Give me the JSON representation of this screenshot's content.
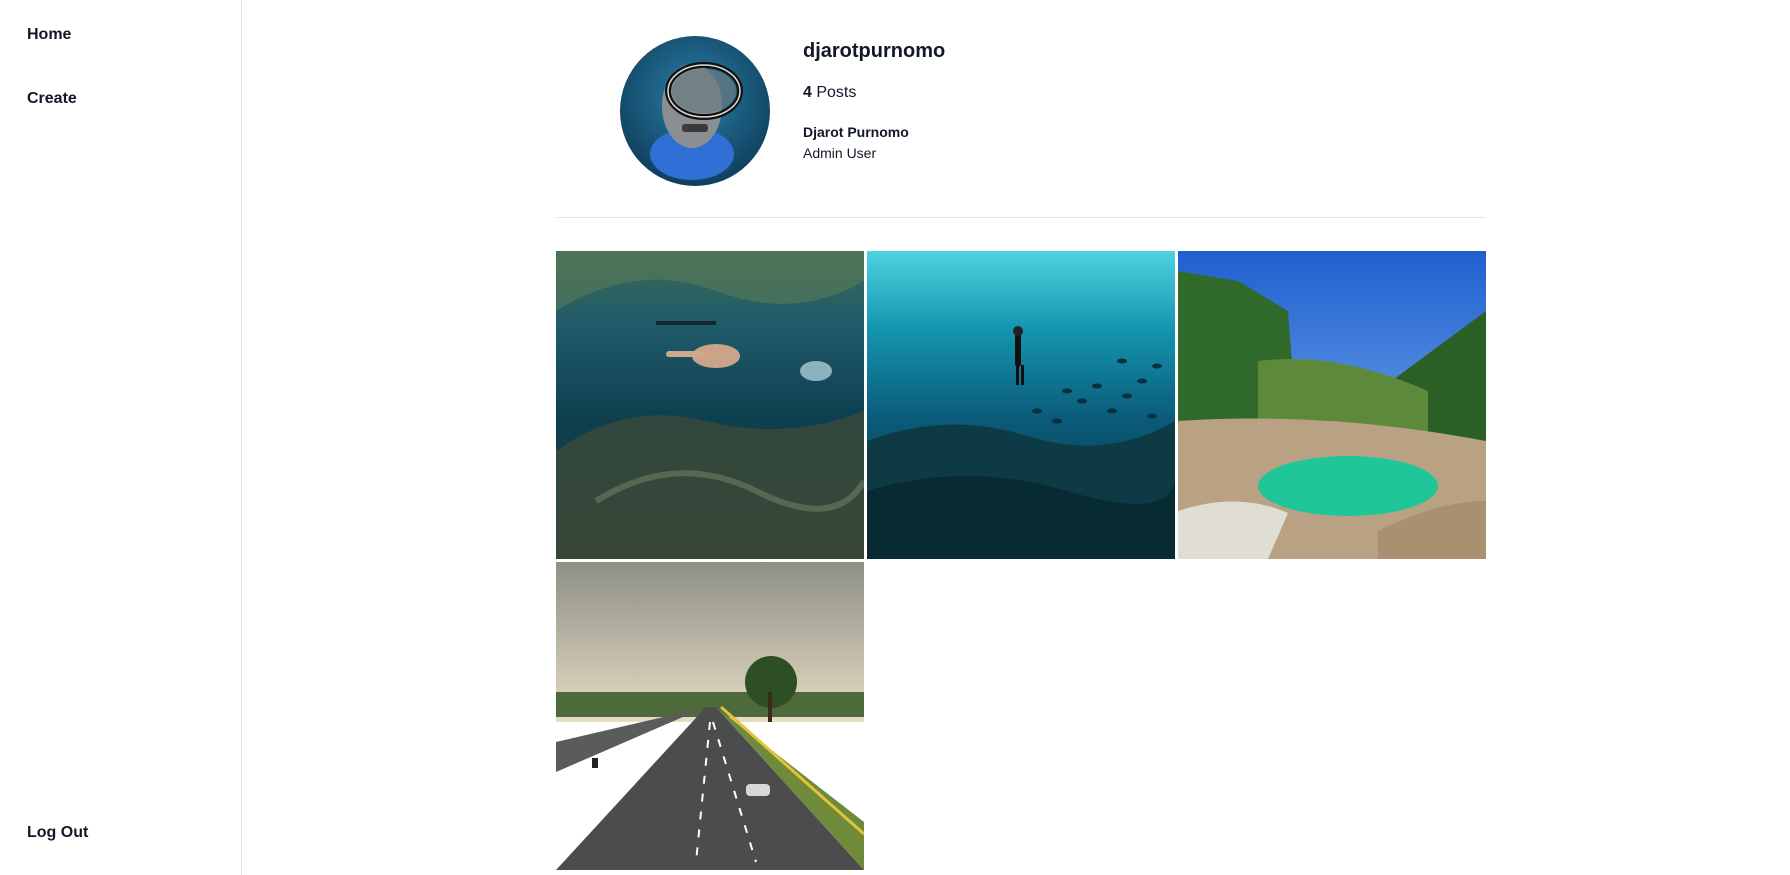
{
  "sidebar": {
    "home": "Home",
    "create": "Create",
    "logout": "Log Out"
  },
  "profile": {
    "username": "djarotpurnomo",
    "post_count": "4",
    "posts_label": "Posts",
    "full_name": "Djarot Purnomo",
    "bio": "Admin User"
  },
  "posts": [
    {
      "scene": "snorkeler-underwater"
    },
    {
      "scene": "freediver-with-fish"
    },
    {
      "scene": "waterfall-green-pool"
    },
    {
      "scene": "highway-road"
    }
  ]
}
